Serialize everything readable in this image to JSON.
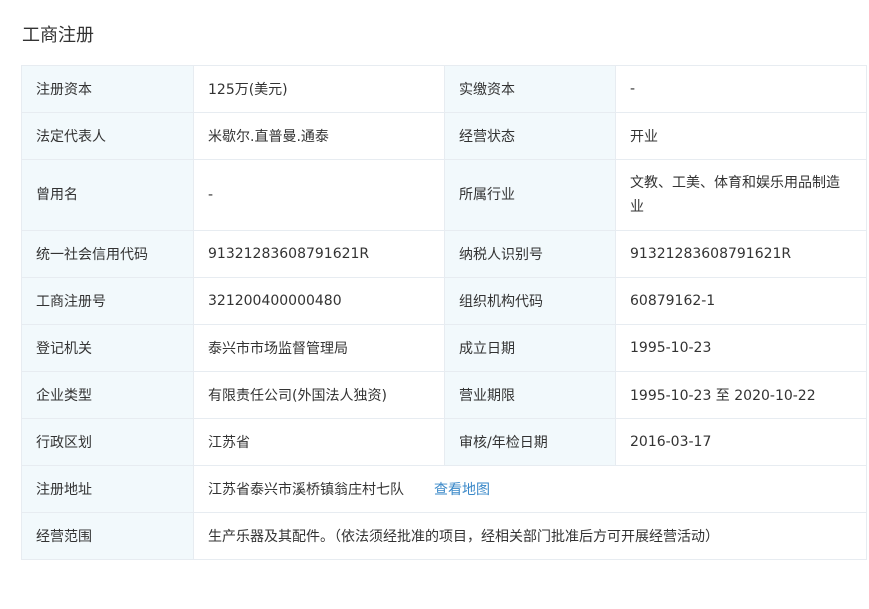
{
  "section": {
    "title": "工商注册"
  },
  "rows": [
    {
      "l1": "注册资本",
      "v1": "125万(美元)",
      "l2": "实缴资本",
      "v2": "-"
    },
    {
      "l1": "法定代表人",
      "v1": "米歇尔.直普曼.通泰",
      "l2": "经营状态",
      "v2": "开业"
    },
    {
      "l1": "曾用名",
      "v1": "-",
      "l2": "所属行业",
      "v2": "文教、工美、体育和娱乐用品制造业"
    },
    {
      "l1": "统一社会信用代码",
      "v1": "91321283608791621R",
      "l2": "纳税人识别号",
      "v2": "91321283608791621R"
    },
    {
      "l1": "工商注册号",
      "v1": "321200400000480",
      "l2": "组织机构代码",
      "v2": "60879162-1"
    },
    {
      "l1": "登记机关",
      "v1": "泰兴市市场监督管理局",
      "l2": "成立日期",
      "v2": "1995-10-23"
    },
    {
      "l1": "企业类型",
      "v1": "有限责任公司(外国法人独资)",
      "l2": "营业期限",
      "v2": "1995-10-23 至 2020-10-22"
    },
    {
      "l1": "行政区划",
      "v1": "江苏省",
      "l2": "审核/年检日期",
      "v2": "2016-03-17"
    }
  ],
  "address": {
    "label": "注册地址",
    "value": "江苏省泰兴市溪桥镇翁庄村七队",
    "map_link": "查看地图"
  },
  "scope": {
    "label": "经营范围",
    "value": "生产乐器及其配件。（依法须经批准的项目，经相关部门批准后方可开展经营活动）"
  }
}
